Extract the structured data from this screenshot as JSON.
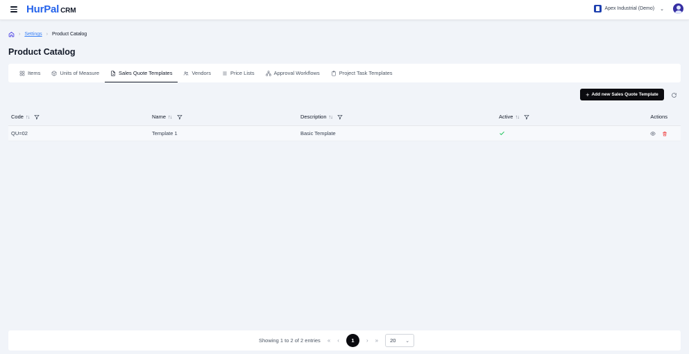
{
  "header": {
    "logo_main": "HurPal",
    "logo_suffix": "CRM",
    "company": "Apex Industrial (Demo)"
  },
  "breadcrumb": {
    "settings": "Settings",
    "current": "Product Catalog"
  },
  "page_title": "Product Catalog",
  "tabs": [
    {
      "label": "Items",
      "icon": "grid-icon"
    },
    {
      "label": "Units of Measure",
      "icon": "box-icon"
    },
    {
      "label": "Sales Quote Templates",
      "icon": "document-icon",
      "active": true
    },
    {
      "label": "Vendors",
      "icon": "users-icon"
    },
    {
      "label": "Price Lists",
      "icon": "list-icon"
    },
    {
      "label": "Approval Workflows",
      "icon": "workflow-icon"
    },
    {
      "label": "Project Task Templates",
      "icon": "clipboard-icon"
    }
  ],
  "toolbar": {
    "add_label": "Add new Sales Quote Template"
  },
  "table": {
    "columns": {
      "code": "Code",
      "name": "Name",
      "description": "Description",
      "active": "Active",
      "actions": "Actions"
    },
    "rows": [
      {
        "code": "QU=02",
        "name": "Template 1",
        "description": "Basic Template",
        "active": true
      }
    ]
  },
  "pagination": {
    "summary": "Showing 1 to 2 of 2 entries",
    "first": "«",
    "prev": "‹",
    "page": "1",
    "next": "›",
    "last": "»",
    "per_page": "20"
  },
  "colors": {
    "brand": "#2563eb",
    "primary_button": "#0b0b0f",
    "active_check": "#22c55e",
    "delete": "#ef4444"
  }
}
